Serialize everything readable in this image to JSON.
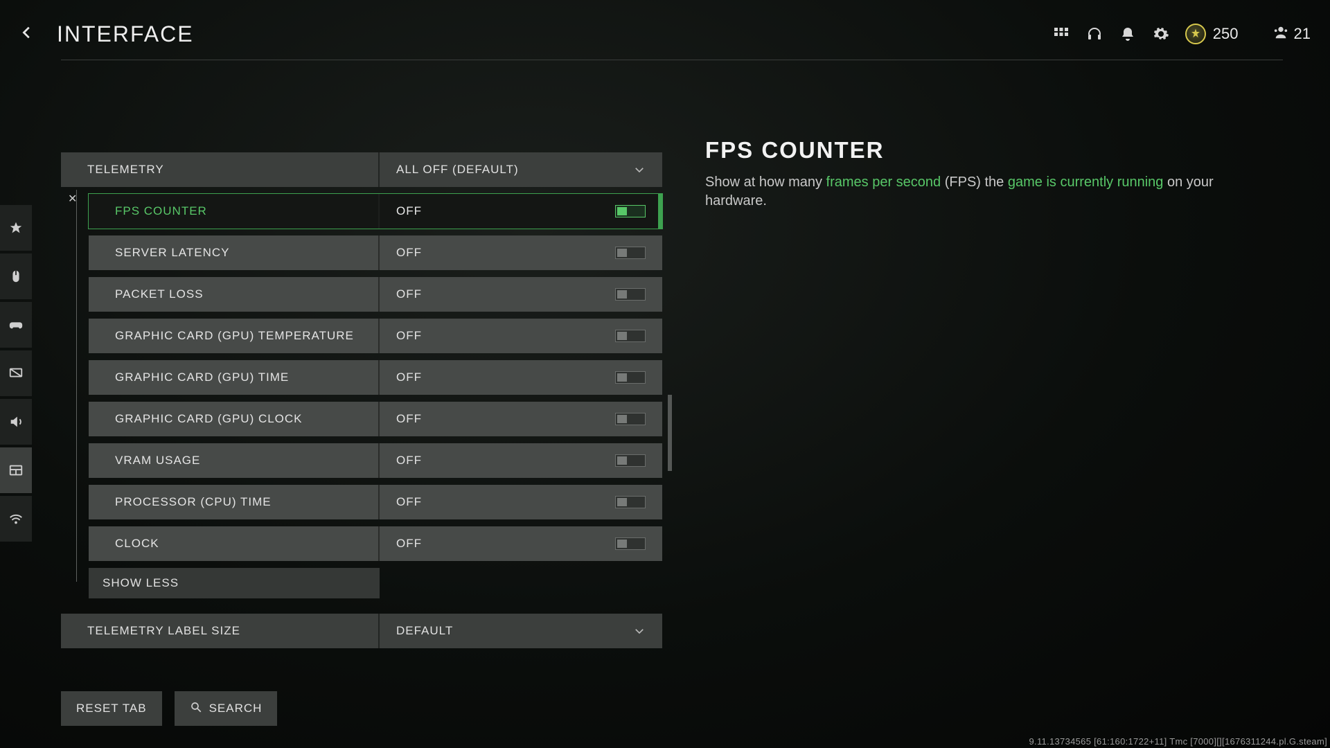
{
  "header": {
    "title": "INTERFACE",
    "currency": "250",
    "players": "21"
  },
  "sidebar": {
    "items": [
      {
        "name": "star"
      },
      {
        "name": "mouse"
      },
      {
        "name": "controller"
      },
      {
        "name": "display"
      },
      {
        "name": "audio"
      },
      {
        "name": "interface",
        "active": true
      },
      {
        "name": "network"
      }
    ]
  },
  "telemetry": {
    "section_label": "TELEMETRY",
    "section_value": "ALL OFF (DEFAULT)",
    "items": [
      {
        "label": "FPS COUNTER",
        "value": "OFF",
        "selected": true
      },
      {
        "label": "SERVER LATENCY",
        "value": "OFF"
      },
      {
        "label": "PACKET LOSS",
        "value": "OFF"
      },
      {
        "label": "GRAPHIC CARD (GPU) TEMPERATURE",
        "value": "OFF"
      },
      {
        "label": "GRAPHIC CARD (GPU) TIME",
        "value": "OFF"
      },
      {
        "label": "GRAPHIC CARD (GPU) CLOCK",
        "value": "OFF"
      },
      {
        "label": "VRAM USAGE",
        "value": "OFF"
      },
      {
        "label": "PROCESSOR (CPU) TIME",
        "value": "OFF"
      },
      {
        "label": "CLOCK",
        "value": "OFF"
      }
    ],
    "show_less": "SHOW LESS",
    "label_size_label": "TELEMETRY LABEL SIZE",
    "label_size_value": "DEFAULT"
  },
  "description": {
    "title": "FPS COUNTER",
    "pre1": "Show at how many ",
    "hl1": "frames per second",
    "mid1": " (FPS) the ",
    "hl2": "game is currently running",
    "post1": " on your hardware."
  },
  "buttons": {
    "reset": "RESET TAB",
    "search": "SEARCH"
  },
  "build": "9.11.13734565 [61:160:1722+11] Tmc [7000][][1676311244.pl.G.steam]"
}
